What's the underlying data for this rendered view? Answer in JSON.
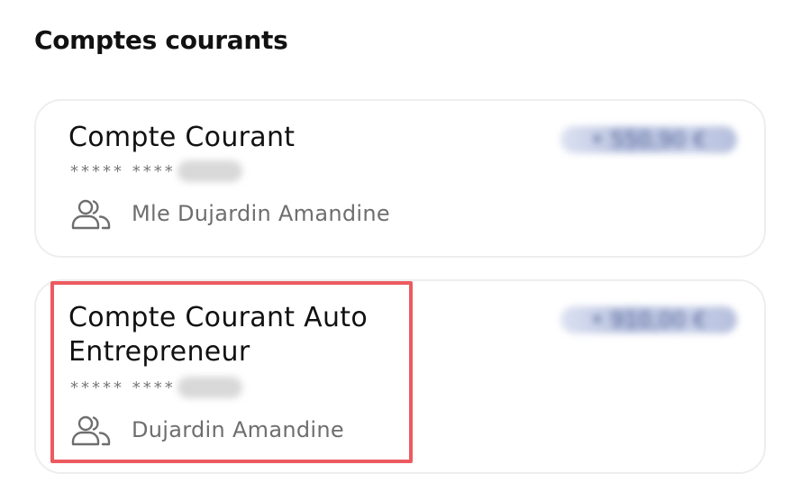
{
  "section": {
    "title": "Comptes courants"
  },
  "accounts": [
    {
      "name": "Compte Courant",
      "masked_number": "***** ****",
      "balance": "• 550,90 €",
      "holder": "Mle Dujardin Amandine"
    },
    {
      "name": "Compte Courant Auto Entrepreneur",
      "masked_number": "***** ****",
      "balance": "• 910,00 €",
      "holder": "Dujardin Amandine"
    }
  ],
  "icons": {
    "holder": "people-icon"
  },
  "colors": {
    "highlight": "#ec5b60",
    "card_border": "#eeeeee"
  }
}
